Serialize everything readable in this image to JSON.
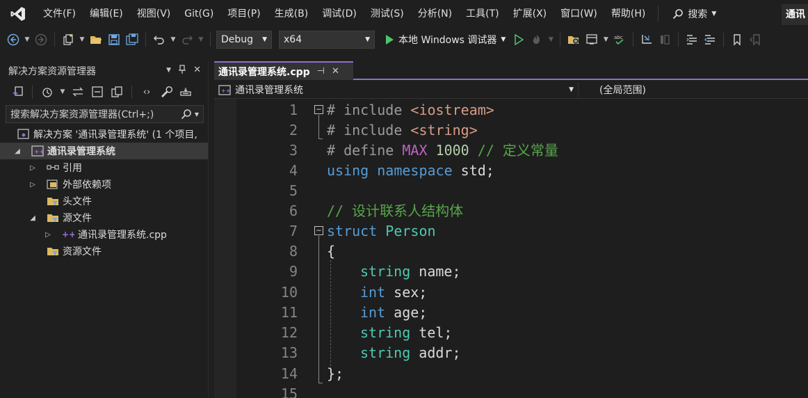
{
  "menu": {
    "items": [
      "文件(F)",
      "编辑(E)",
      "视图(V)",
      "Git(G)",
      "项目(P)",
      "生成(B)",
      "调试(D)",
      "测试(S)",
      "分析(N)",
      "工具(T)",
      "扩展(X)",
      "窗口(W)",
      "帮助(H)"
    ],
    "search_label": "搜索",
    "title_badge": "通讯"
  },
  "toolbar": {
    "config": "Debug",
    "platform": "x64",
    "run_label": "本地 Windows 调试器"
  },
  "solution_explorer": {
    "title": "解决方案资源管理器",
    "search_placeholder": "搜索解决方案资源管理器(Ctrl+;)",
    "tree": [
      {
        "label": "解决方案 '通讯录管理系统' (1 个项目,",
        "level": 0
      },
      {
        "label": "通讯录管理系统",
        "level": 1
      },
      {
        "label": "引用",
        "level": 2
      },
      {
        "label": "外部依赖项",
        "level": 2
      },
      {
        "label": "头文件",
        "level": 2
      },
      {
        "label": "源文件",
        "level": 2
      },
      {
        "label": "通讯录管理系统.cpp",
        "level": 3
      },
      {
        "label": "资源文件",
        "level": 2
      }
    ]
  },
  "editor": {
    "tab_label": "通讯录管理系统.cpp",
    "nav_scope": "通讯录管理系统",
    "nav_member": "(全局范围)",
    "line_numbers": [
      "1",
      "2",
      "3",
      "4",
      "5",
      "6",
      "7",
      "8",
      "9",
      "10",
      "11",
      "12",
      "13",
      "14",
      "15"
    ],
    "code": {
      "l1_hash": "# ",
      "l1_kw": "include ",
      "l1_str": "<iostream>",
      "l2_hash": "# ",
      "l2_kw": "include ",
      "l2_str": "<string>",
      "l3_hash": "# ",
      "l3_kw": "define ",
      "l3_mac": "MAX",
      "l3_num": " 1000",
      "l3_cmt": " // 定义常量",
      "l4_kw1": "using",
      "l4_kw2": " namespace",
      "l4_id": " std;",
      "l6_cmt": "// 设计联系人结构体",
      "l7_kw": "struct",
      "l7_typ": " Person",
      "l8_brace": "{",
      "l9_typ": "string",
      "l9_id": " name;",
      "l10_kw": "int",
      "l10_id": " sex;",
      "l11_kw": "int",
      "l11_id": " age;",
      "l12_typ": "string",
      "l12_id": " tel;",
      "l13_typ": "string",
      "l13_id": " addr;",
      "l14_id": "};"
    }
  },
  "colors": {
    "accent": "#8e6fd1",
    "keyword": "#569cd6",
    "type": "#4ec9b0",
    "string": "#d69d85",
    "comment": "#57a64a",
    "macro": "#bd63c5"
  }
}
